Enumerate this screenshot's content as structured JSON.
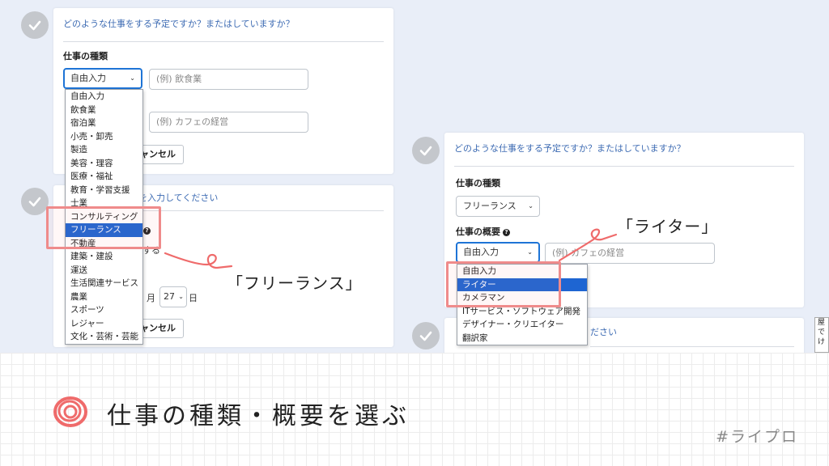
{
  "left": {
    "question": "どのような仕事をする予定ですか？またはしていますか？",
    "type_label": "仕事の種類",
    "type_select": "自由入力",
    "type_placeholder": "(例) 飲食業",
    "summary_placeholder": "(例) カフェの経営",
    "cancel1": "ャンセル",
    "card2_heading": "を入力してください",
    "partial_suru": "する",
    "month_label": "月",
    "day_value": "27",
    "day_label": "日",
    "cancel2": "ャンセル",
    "type_options": [
      "自由入力",
      "飲食業",
      "宿泊業",
      "小売・卸売",
      "製造",
      "美容・理容",
      "医療・福祉",
      "教育・学習支援",
      "士業",
      "コンサルティング",
      "フリーランス",
      "不動産",
      "建築・建設",
      "運送",
      "生活関連サービス",
      "農業",
      "スポーツ",
      "レジャー",
      "文化・芸術・芸能"
    ],
    "selected_index": 10
  },
  "right": {
    "question": "どのような仕事をする予定ですか？またはしていますか？",
    "type_label": "仕事の種類",
    "type_select": "フリーランス",
    "summary_label": "仕事の概要",
    "summary_select": "自由入力",
    "summary_placeholder": "(例) カフェの経営",
    "card2_heading": "ださい",
    "summary_options": [
      "自由入力",
      "ライター",
      "カメラマン",
      "ITサービス・ソフトウェア開発",
      "デザイナー・クリエイター",
      "翻訳家"
    ],
    "selected_index": 1
  },
  "annotations": {
    "freelance": "「フリーランス」",
    "writer": "「ライター」"
  },
  "side_snippet": "屋\nで\nけ",
  "footer": {
    "title": "仕事の種類・概要を選ぶ",
    "hashtag": "#ライプロ"
  },
  "colors": {
    "accent": "#1e65d2",
    "highlight": "#ef8b8b",
    "heading_text": "#3d6bb3",
    "check_gray": "#c4c7cc"
  }
}
